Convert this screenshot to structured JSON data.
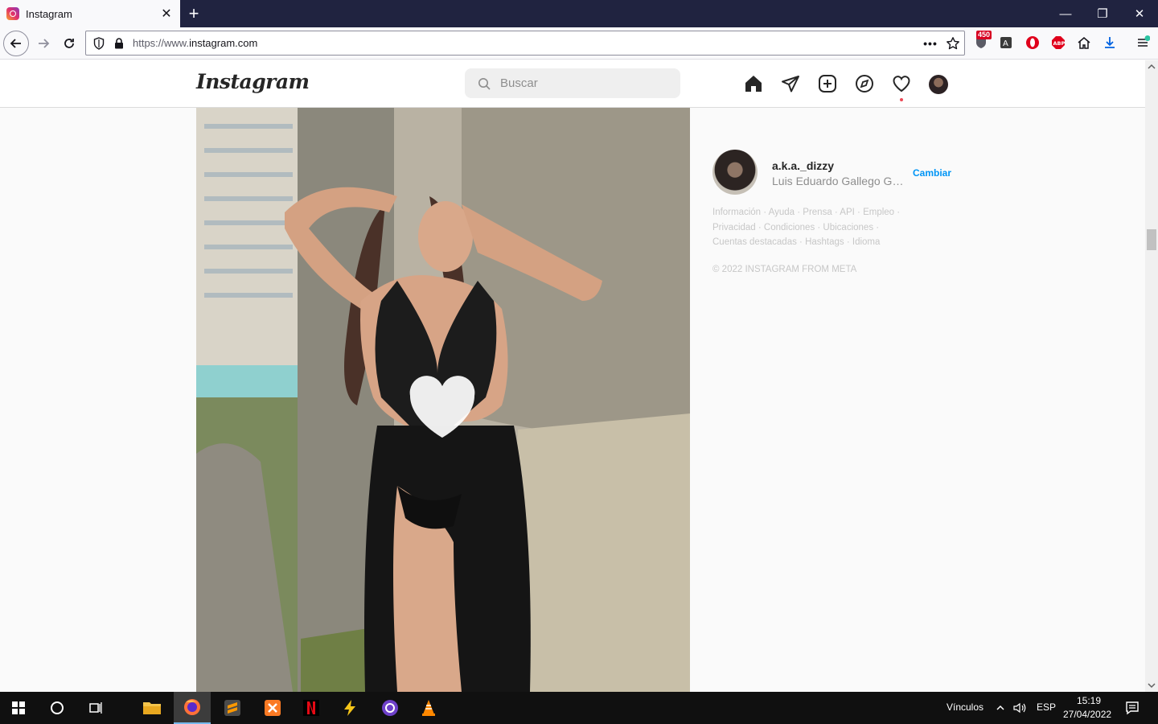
{
  "browser": {
    "tab_title": "Instagram",
    "tab_close": "✕",
    "new_tab": "+",
    "url_prefix": "https://www.",
    "url_domain": "instagram.com",
    "url_dots": "•••",
    "extension_badge": "450",
    "window_controls": {
      "minimize": "—",
      "restore": "❐",
      "close": "✕"
    }
  },
  "instagram": {
    "logo": "Instagram",
    "search_placeholder": "Buscar",
    "nav_icons": [
      "home-icon",
      "direct-icon",
      "new-post-icon",
      "explore-icon",
      "activity-icon",
      "profile-avatar"
    ]
  },
  "sidebar": {
    "username": "a.k.a._dizzy",
    "full_name": "Luis Eduardo Gallego Gar...",
    "switch_label": "Cambiar",
    "footer_line1": "Información · Ayuda · Prensa · API · Empleo ·",
    "footer_line2": "Privacidad · Condiciones · Ubicaciones ·",
    "footer_line3": "Cuentas destacadas · Hashtags · Idioma",
    "copyright": "© 2022 INSTAGRAM FROM META"
  },
  "taskbar": {
    "links_label": "Vínculos",
    "language": "ESP",
    "time": "15:19",
    "date": "27/04/2022"
  },
  "colors": {
    "tab_strip": "#202340",
    "instagram_blue": "#0095f6",
    "notification_red": "#ed4956",
    "taskbar": "#101010"
  }
}
